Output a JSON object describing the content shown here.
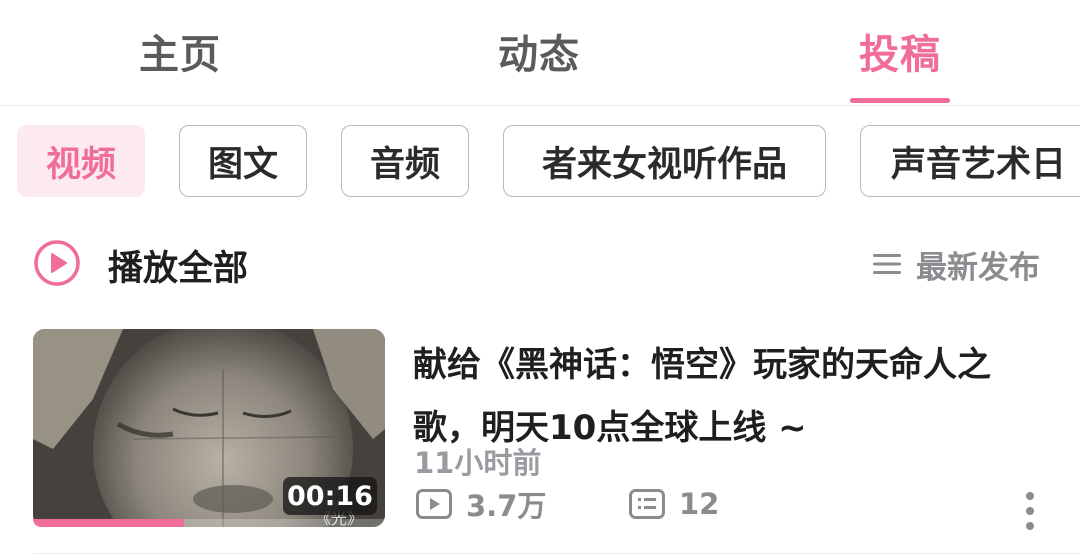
{
  "top_tabs": [
    {
      "label": "主页",
      "active": false
    },
    {
      "label": "动态",
      "active": false
    },
    {
      "label": "投稿",
      "active": true
    }
  ],
  "chips": [
    {
      "label": "视频",
      "active": true
    },
    {
      "label": "图文",
      "active": false
    },
    {
      "label": "音频",
      "active": false
    },
    {
      "label": "者来女视听作品",
      "active": false
    },
    {
      "label": "声音艺术日",
      "active": false
    }
  ],
  "play_all": {
    "label": "播放全部",
    "icon": "play-circle-icon"
  },
  "sort": {
    "label": "最新发布",
    "icon": "list-sort-icon"
  },
  "video": {
    "title_line1": "献给《黑神话：悟空》玩家的天命人之",
    "title_line2": "歌，明天10点全球上线 ~",
    "duration": "00:16",
    "thumbnail_text": "《光》",
    "time_ago": "11小时前",
    "views": "3.7万",
    "comments": "12",
    "watch_progress": 0.43
  },
  "colors": {
    "accent": "#f06d9a",
    "muted": "#8b8b90",
    "text": "#1f1f22"
  }
}
